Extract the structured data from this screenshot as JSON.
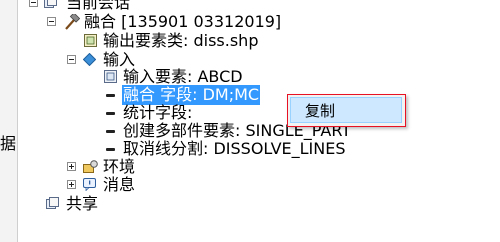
{
  "tree": {
    "current_session": "当前会话",
    "merge_process": "融合 [135901 03312019]",
    "output_feature_class": "输出要素类: diss.shp",
    "input_group": "输入",
    "input_feature": "输入要素: ABCD",
    "dissolve_field": "融合 字段: DM;MC",
    "statistics_field": "统计字段:",
    "create_multipart": "创建多部件要素: SINGLE_PART",
    "unsplit_lines": "取消线分割: DISSOLVE_LINES",
    "environment": "环境",
    "messages": "消息",
    "shared": "共享"
  },
  "left_panel": {
    "edge_char": "据"
  },
  "context_menu": {
    "copy_label": "复制"
  },
  "colors": {
    "selection": "#3399ff",
    "menu_highlight": "#cde8ff",
    "annotation": "#e81123"
  }
}
